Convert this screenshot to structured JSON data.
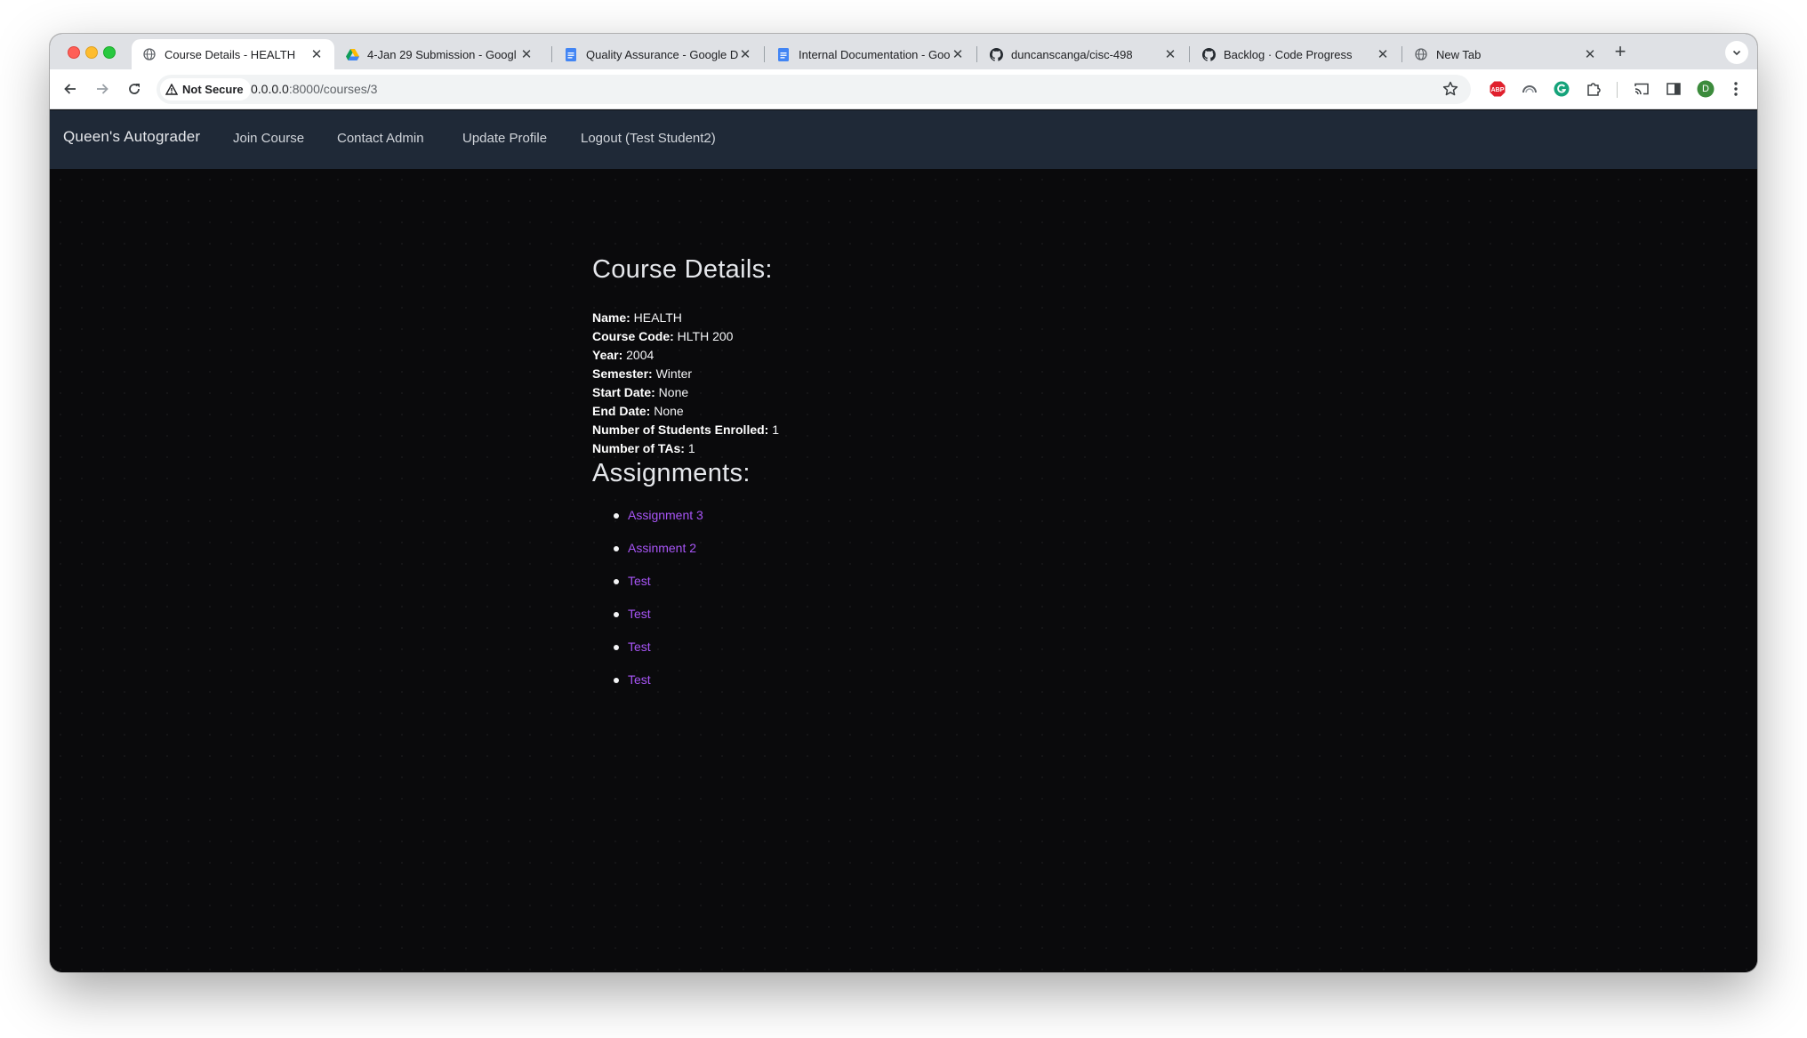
{
  "browser": {
    "tabs": [
      {
        "title": "Course Details - HEALTH",
        "icon": "globe-icon",
        "active": true
      },
      {
        "title": "4-Jan 29 Submission - Googl",
        "icon": "google-drive-icon",
        "active": false
      },
      {
        "title": "Quality Assurance - Google D",
        "icon": "google-docs-icon",
        "active": false
      },
      {
        "title": "Internal Documentation - Goo",
        "icon": "google-docs-icon",
        "active": false
      },
      {
        "title": "duncanscanga/cisc-498",
        "icon": "github-icon",
        "active": false
      },
      {
        "title": "Backlog · Code Progress",
        "icon": "github-icon",
        "active": false
      },
      {
        "title": "New Tab",
        "icon": "globe-icon",
        "active": false
      }
    ],
    "security_label": "Not Secure",
    "url_host": "0.0.0.0",
    "url_rest": ":8000/courses/3",
    "profile_initial": "D",
    "colors": {
      "profile": "#3c8b3c",
      "abp": "#e0202d",
      "grammarly": "#15a37a"
    }
  },
  "site": {
    "brand": "Queen's Autograder",
    "nav": {
      "join": "Join Course",
      "contact": "Contact Admin",
      "profile": "Update Profile",
      "logout": "Logout (Test Student2)"
    }
  },
  "course": {
    "heading": "Course Details:",
    "fields": [
      {
        "label": "Name:",
        "value": " HEALTH"
      },
      {
        "label": "Course Code:",
        "value": " HLTH 200"
      },
      {
        "label": "Year:",
        "value": " 2004"
      },
      {
        "label": "Semester:",
        "value": " Winter"
      },
      {
        "label": "Start Date:",
        "value": " None"
      },
      {
        "label": "End Date:",
        "value": " None"
      },
      {
        "label": "Number of Students Enrolled:",
        "value": " 1"
      },
      {
        "label": "Number of TAs:",
        "value": " 1"
      }
    ]
  },
  "assignments": {
    "heading": "Assignments:",
    "items": [
      "Assignment 3",
      "Assinment 2",
      "Test",
      "Test",
      "Test",
      "Test"
    ],
    "link_color": "#a855f7"
  }
}
